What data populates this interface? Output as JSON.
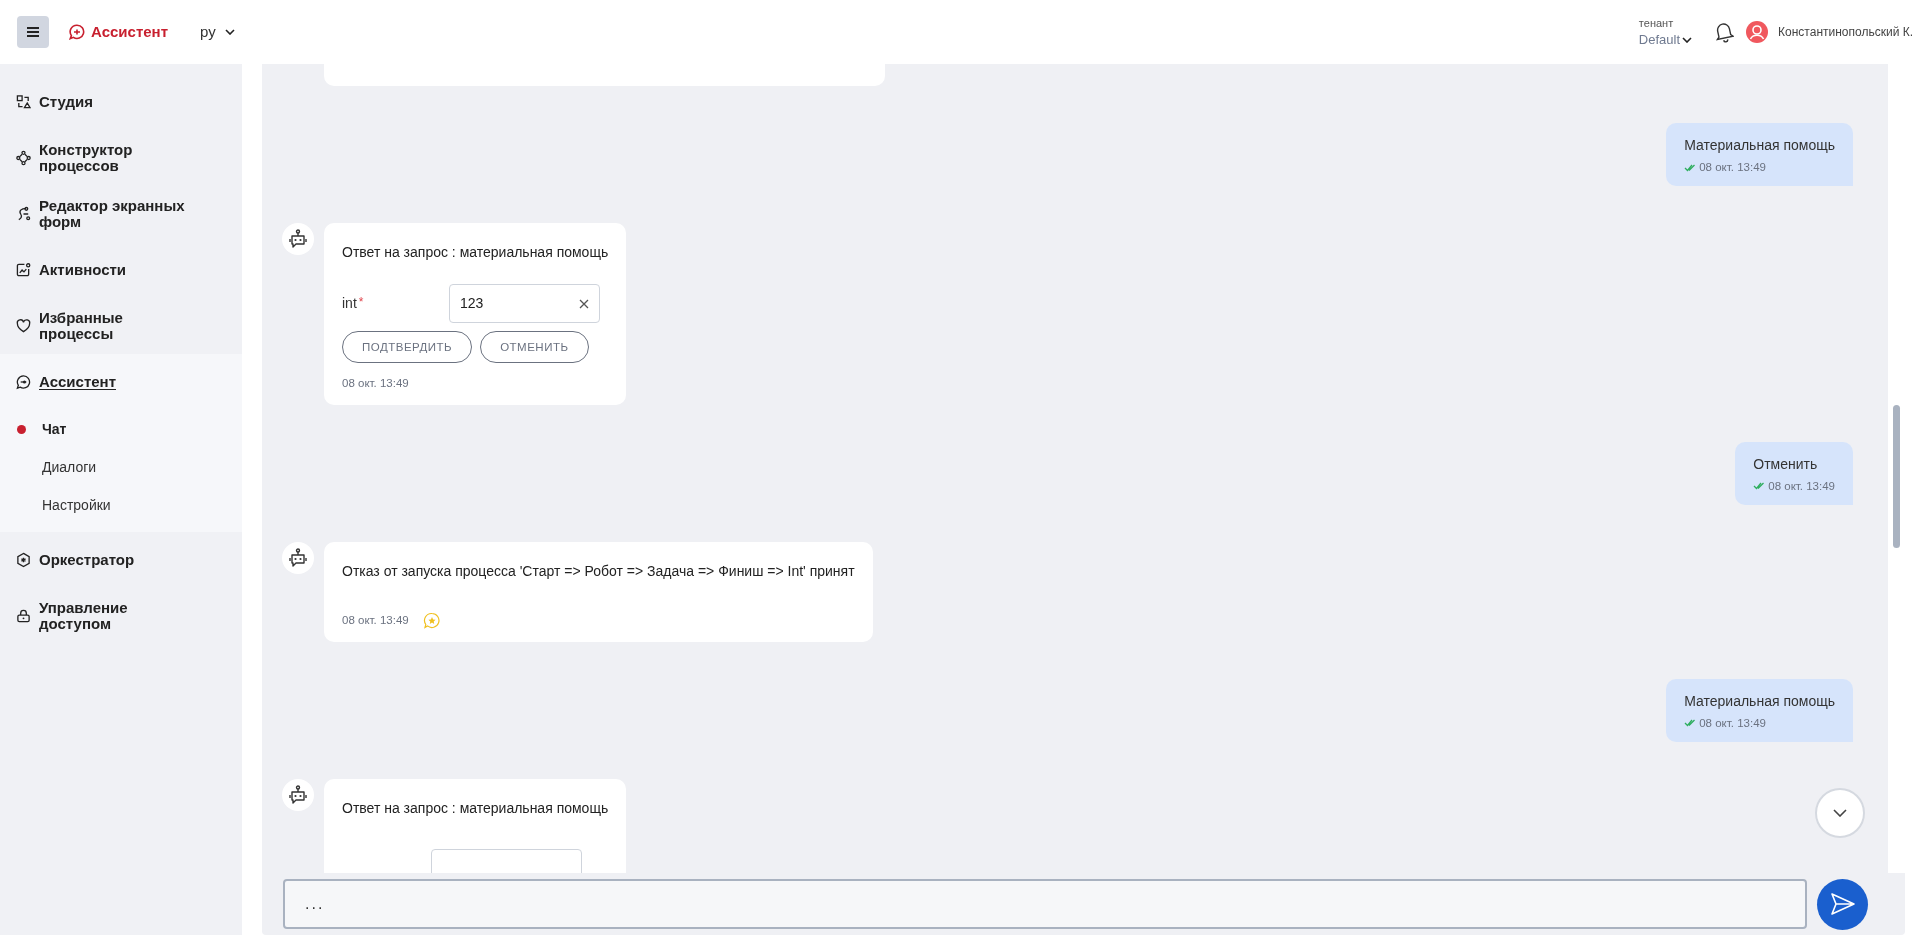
{
  "header": {
    "app_title": "Ассистент",
    "language": "ру",
    "tenant_label": "тенант",
    "tenant_value": "Default",
    "user_name": "Константинопольский К."
  },
  "sidebar": {
    "items": [
      {
        "label": "Студия",
        "kind": "studio",
        "selected": false
      },
      {
        "label": "Конструктор процессов",
        "kind": "process",
        "selected": false
      },
      {
        "label": "Редактор экранных форм",
        "kind": "forms",
        "selected": false
      },
      {
        "label": "Активности",
        "kind": "activity",
        "selected": false
      },
      {
        "label": "Избранные процессы",
        "kind": "heart",
        "selected": false
      },
      {
        "label": "Ассистент",
        "kind": "chat",
        "selected": true,
        "expanded": true,
        "children": [
          {
            "label": "Чат",
            "selected": true
          },
          {
            "label": "Диалоги",
            "selected": false
          },
          {
            "label": "Настройки",
            "selected": false
          }
        ]
      },
      {
        "label": "Оркестратор",
        "kind": "orchestrator",
        "selected": false
      },
      {
        "label": "Управление доступом",
        "kind": "access",
        "selected": false
      }
    ]
  },
  "messages": [
    {
      "kind": "bot_clipped"
    },
    {
      "kind": "user",
      "text": "Материальная помощь",
      "time": "08 окт. 13:49",
      "delivered": true
    },
    {
      "kind": "bot_form",
      "text": "Ответ на запрос : материальная помощь",
      "field": {
        "label": "int",
        "required_mark": "*",
        "value": "123"
      },
      "buttons": [
        "ПОДТВЕРДИТЬ",
        "ОТМЕНИТЬ"
      ],
      "time": "08 окт. 13:49"
    },
    {
      "kind": "user",
      "text": "Отменить",
      "time": "08 окт. 13:49",
      "delivered": true
    },
    {
      "kind": "bot",
      "text": "Отказ от запуска процесса 'Старт => Робот => Задача => Финиш => Int' принят",
      "time": "08 окт. 13:49"
    },
    {
      "kind": "user",
      "text": "Материальная помощь",
      "time": "08 окт. 13:49",
      "delivered": true
    },
    {
      "kind": "bot_form_cut",
      "text": "Ответ на запрос : материальная помощь"
    }
  ],
  "composer": {
    "value": "..."
  }
}
